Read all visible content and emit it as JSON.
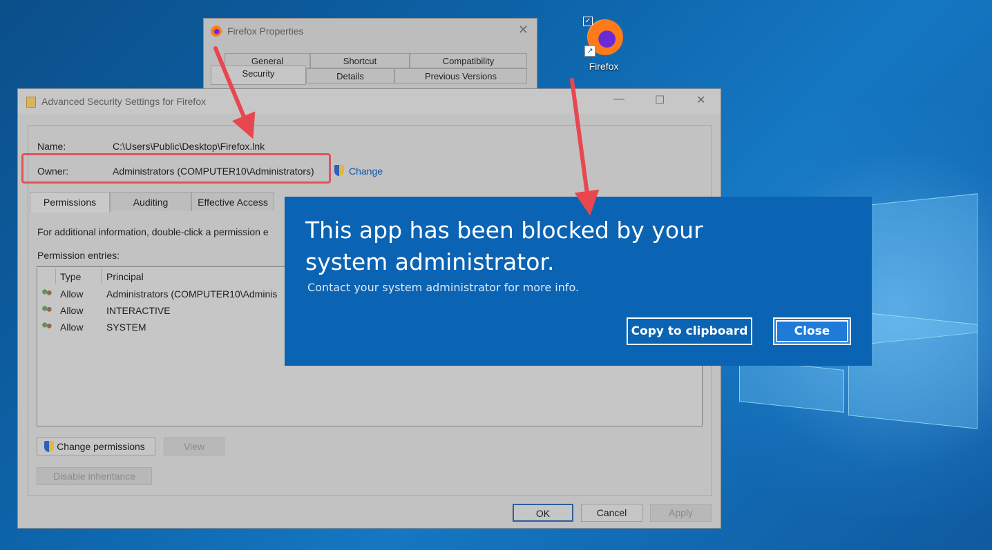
{
  "desktop": {
    "icon_label": "Firefox",
    "checkbox": "✓",
    "shortcut_glyph": "↗"
  },
  "properties_window": {
    "title": "Firefox Properties",
    "close_glyph": "✕",
    "tabs_row1": [
      "General",
      "Shortcut",
      "Compatibility"
    ],
    "tabs_row2": [
      "Security",
      "Details",
      "Previous Versions"
    ]
  },
  "advanced_window": {
    "title": "Advanced Security Settings for Firefox",
    "minimize_glyph": "—",
    "maximize_glyph": "☐",
    "close_glyph": "✕",
    "name_label": "Name:",
    "name_value": "C:\\Users\\Public\\Desktop\\Firefox.lnk",
    "owner_label": "Owner:",
    "owner_value": "Administrators (COMPUTER10\\Administrators)",
    "change_link": "Change",
    "tabs": [
      "Permissions",
      "Auditing",
      "Effective Access"
    ],
    "info_text": "For additional information, double-click a permission e",
    "entries_label": "Permission entries:",
    "columns": [
      "Type",
      "Principal"
    ],
    "rows": [
      {
        "type": "Allow",
        "principal": "Administrators (COMPUTER10\\Adminis"
      },
      {
        "type": "Allow",
        "principal": "INTERACTIVE"
      },
      {
        "type": "Allow",
        "principal": "SYSTEM"
      }
    ],
    "change_permissions_button": "Change permissions",
    "view_button": "View",
    "disable_inheritance_button": "Disable inheritance",
    "ok_button": "OK",
    "cancel_button": "Cancel",
    "apply_button": "Apply"
  },
  "block_dialog": {
    "title": "This app has been blocked by your system administrator.",
    "message": "Contact your system administrator for more info.",
    "copy_button": "Copy to clipboard",
    "close_button": "Close",
    "background_color": "#0b63b3"
  },
  "annotation_color": "#e8474f"
}
